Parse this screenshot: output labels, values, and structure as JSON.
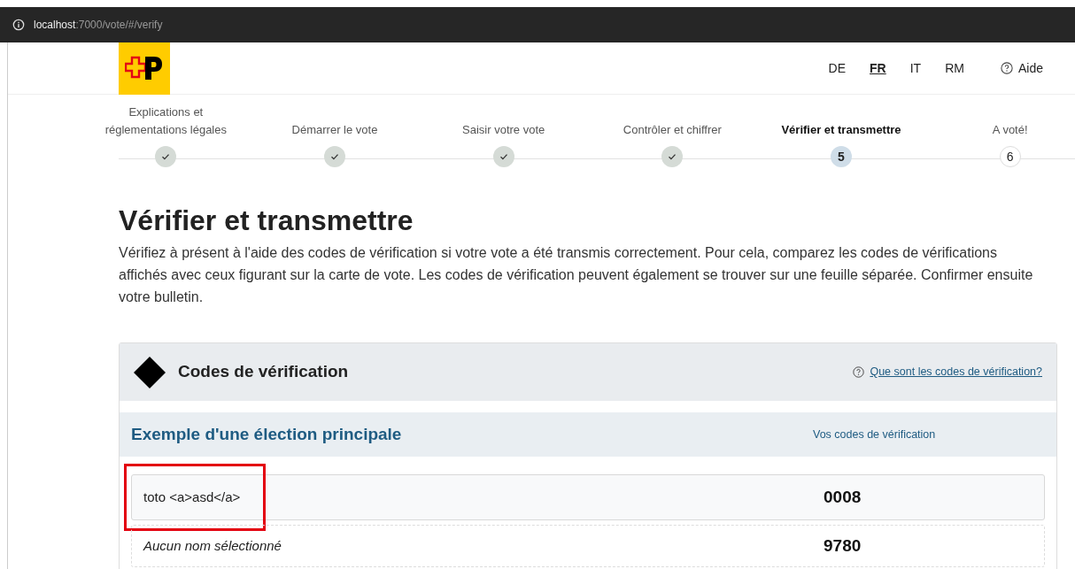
{
  "browser": {
    "url_host": "localhost",
    "url_rest": ":7000/vote/#/verify"
  },
  "header": {
    "languages": [
      {
        "label": "DE",
        "selected": false
      },
      {
        "label": "FR",
        "selected": true
      },
      {
        "label": "IT",
        "selected": false
      },
      {
        "label": "RM",
        "selected": false
      }
    ],
    "help": "Aide"
  },
  "steps": [
    {
      "label": "Explications et réglementations légales",
      "kind": "done"
    },
    {
      "label": "Démarrer le vote",
      "kind": "done"
    },
    {
      "label": "Saisir votre vote",
      "kind": "done"
    },
    {
      "label": "Contrôler et chiffrer",
      "kind": "done"
    },
    {
      "label": "Vérifier et transmettre",
      "kind": "current",
      "number": "5"
    },
    {
      "label": "A voté!",
      "kind": "todo",
      "number": "6"
    }
  ],
  "title": "Vérifier et transmettre",
  "intro": "Vérifiez à présent à l'aide des codes de vérification si votre vote a été transmis correctement. Pour cela, comparez les codes de vérifications affichés avec ceux figurant sur la carte de vote. Les codes de vérification peuvent également se trouver sur une feuille séparée. Confirmer ensuite votre bulletin.",
  "card": {
    "title": "Codes de vérification",
    "help_link": "Que sont les codes de vérification?",
    "section": {
      "title": "Exemple d'une élection principale",
      "column": "Vos codes de vérification",
      "rows": [
        {
          "name": "toto <a>asd</a>",
          "code": "0008",
          "kind": "chosen",
          "highlighted": true
        },
        {
          "name": "Aucun nom sélectionné",
          "code": "9780",
          "kind": "none",
          "highlighted": false
        }
      ]
    }
  }
}
